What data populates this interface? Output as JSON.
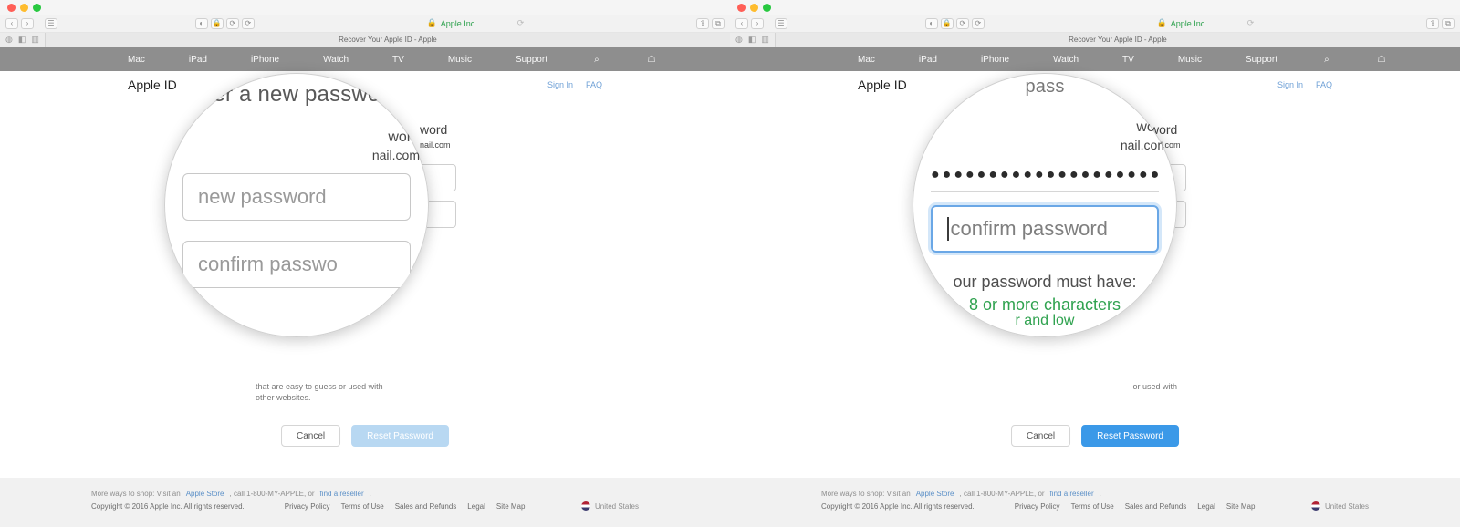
{
  "chrome": {
    "addr_host": "Apple Inc.",
    "tab_title": "Recover Your Apple ID - Apple"
  },
  "gnav": {
    "items": [
      "Mac",
      "iPad",
      "iPhone",
      "Watch",
      "TV",
      "Music",
      "Support"
    ]
  },
  "sub": {
    "brand": "Apple ID",
    "signin": "Sign In",
    "faq": "FAQ"
  },
  "form": {
    "heading_suffix": "word",
    "email_suffix": "nail.com",
    "helper_a": "that are easy to guess or used with",
    "helper_b": "other websites.",
    "cancel": "Cancel",
    "reset": "Reset Password"
  },
  "footer": {
    "more_a": "More ways to shop: Visit an ",
    "store": "Apple Store",
    "more_b": ", call 1-800-MY-APPLE, or ",
    "find": "find a reseller",
    "copyright": "Copyright © 2016 Apple Inc. All rights reserved.",
    "links": [
      "Privacy Policy",
      "Terms of Use",
      "Sales and Refunds",
      "Legal",
      "Site Map"
    ],
    "country": "United States"
  },
  "mag_left": {
    "title": "er a new passwo",
    "sub": "word",
    "email": "nail.com",
    "new_ph": "new password",
    "confirm_ph": "confirm passwo"
  },
  "mag_right": {
    "title_frag": "pass",
    "sub": "word",
    "email": "nail.com",
    "dots": "●●●●●●●●●●●●●●●●●●●●",
    "confirm_ph": "confirm password",
    "hint_title": "our password must have:",
    "hint_ok1": "8 or more characters",
    "hint_ok2": "r and low"
  },
  "right_helper": "or used with"
}
